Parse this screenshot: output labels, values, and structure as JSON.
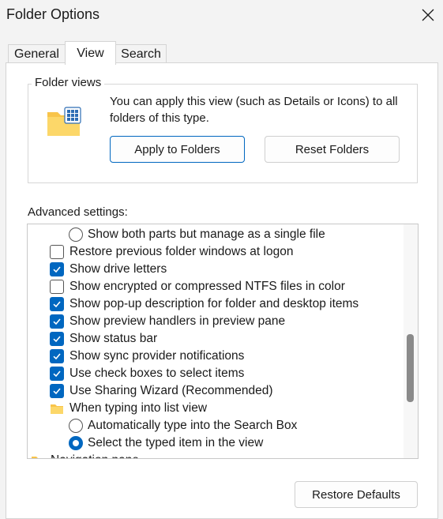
{
  "window": {
    "title": "Folder Options"
  },
  "tabs": [
    {
      "label": "General",
      "active": false
    },
    {
      "label": "View",
      "active": true
    },
    {
      "label": "Search",
      "active": false
    }
  ],
  "folder_views": {
    "legend": "Folder views",
    "description": "You can apply this view (such as Details or Icons) to all folders of this type.",
    "apply_button": "Apply to Folders",
    "reset_button": "Reset Folders"
  },
  "advanced": {
    "label": "Advanced settings:",
    "items": [
      {
        "type": "radio",
        "checked": false,
        "label": "Show both parts but manage as a single file"
      },
      {
        "type": "checkbox",
        "checked": false,
        "label": "Restore previous folder windows at logon"
      },
      {
        "type": "checkbox",
        "checked": true,
        "label": "Show drive letters"
      },
      {
        "type": "checkbox",
        "checked": false,
        "label": "Show encrypted or compressed NTFS files in color"
      },
      {
        "type": "checkbox",
        "checked": true,
        "label": "Show pop-up description for folder and desktop items"
      },
      {
        "type": "checkbox",
        "checked": true,
        "label": "Show preview handlers in preview pane"
      },
      {
        "type": "checkbox",
        "checked": true,
        "label": "Show status bar"
      },
      {
        "type": "checkbox",
        "checked": true,
        "label": "Show sync provider notifications"
      },
      {
        "type": "checkbox",
        "checked": true,
        "label": "Use check boxes to select items"
      },
      {
        "type": "checkbox",
        "checked": true,
        "label": "Use Sharing Wizard (Recommended)"
      },
      {
        "type": "folder",
        "label": "When typing into list view"
      },
      {
        "type": "radio",
        "checked": false,
        "label": "Automatically type into the Search Box"
      },
      {
        "type": "radio",
        "checked": true,
        "label": "Select the typed item in the view"
      },
      {
        "type": "folder",
        "label": "Navigation pane"
      }
    ]
  },
  "restore_defaults_button": "Restore Defaults",
  "colors": {
    "accent": "#0067c0",
    "background": "#f3f3f3",
    "folder": "#f8c44a"
  }
}
